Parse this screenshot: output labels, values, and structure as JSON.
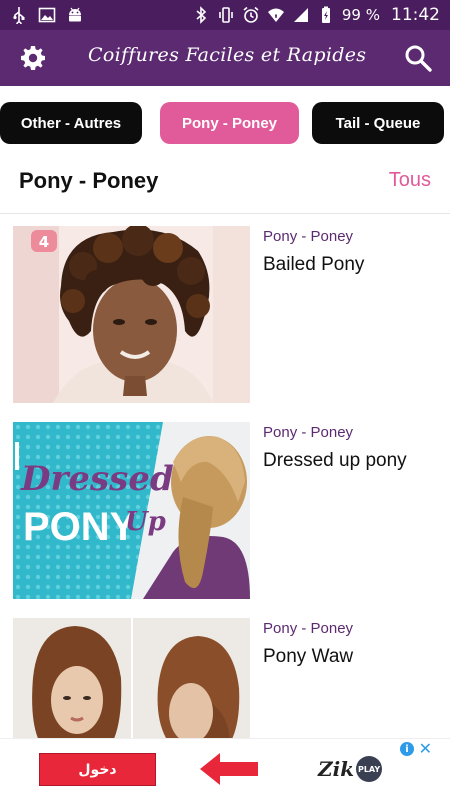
{
  "status_bar": {
    "battery": "99 %",
    "time": "11:42",
    "left_icons": [
      "usb-icon",
      "image-icon",
      "android-icon"
    ],
    "right_icons": [
      "bluetooth-icon",
      "vibrate-icon",
      "alarm-icon",
      "wifi-icon",
      "signal-icon",
      "battery-charging-icon"
    ]
  },
  "app_bar": {
    "title": "Coiffures Faciles et Rapides",
    "left_icon": "gear-icon",
    "right_icon": "search-icon"
  },
  "chips": [
    {
      "label": "Other - Autres",
      "selected": false
    },
    {
      "label": "Pony - Poney",
      "selected": true
    },
    {
      "label": "Tail - Queue",
      "selected": false
    }
  ],
  "section": {
    "title": "Pony - Poney",
    "see_all": "Tous"
  },
  "items": [
    {
      "category": "Pony - Poney",
      "title": "Bailed Pony",
      "badge": "4"
    },
    {
      "category": "Pony - Poney",
      "title": "Dressed up pony",
      "image_text_1": "Dressed",
      "image_text_2": "PONY",
      "image_text_3": "Up"
    },
    {
      "category": "Pony - Poney",
      "title": "Pony Waw"
    }
  ],
  "ad": {
    "button_label": "دخول",
    "logo_text": "Zik",
    "logo_badge": "PLAY",
    "info": "i",
    "close": "✕"
  },
  "colors": {
    "status_bar": "#4a1d5e",
    "app_bar": "#5b2a70",
    "accent_pink": "#e15b9a",
    "chip_dark": "#0c0c0c",
    "category_text": "#5b2a70"
  }
}
